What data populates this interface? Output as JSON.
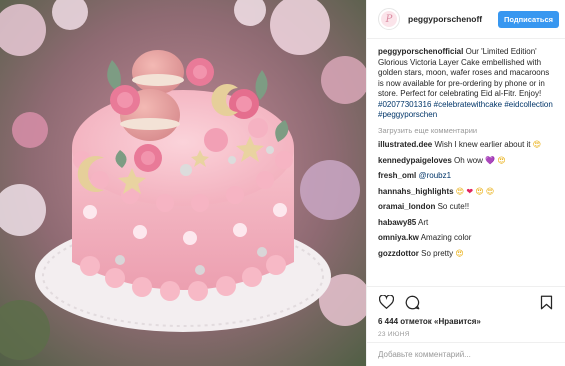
{
  "header": {
    "username": "peggyporschenoff",
    "follow_label": "Подписаться",
    "avatar_letter": "P"
  },
  "caption": {
    "username": "peggyporschenofficial",
    "text": "Our 'Limited Edition' Glorious Victoria Layer Cake embellished with golden stars, moon, wafer roses and macaroons is now available for pre-ordering by phone or in store. Perfect for celebrating Eid al-Fitr. Enjoy!",
    "hashtags": [
      "#02077301316",
      "#celebratewithcake",
      "#eidcollection",
      "#peggyporschen"
    ]
  },
  "load_more": "Загрузить еще комментарии",
  "comments": [
    {
      "username": "illustrated.dee",
      "text": "Wish I knew earlier about it",
      "emojis": [
        {
          "char": "😍",
          "color": "yellow"
        }
      ]
    },
    {
      "username": "kennedypaigeloves",
      "text": "Oh wow",
      "emojis": [
        {
          "char": "💜",
          "color": "purple"
        },
        {
          "char": "😍",
          "color": "yellow"
        }
      ]
    },
    {
      "username": "fresh_oml",
      "text": "",
      "mention": "@roubz1"
    },
    {
      "username": "hannahs_highlights",
      "text": "",
      "emojis": [
        {
          "char": "😍",
          "color": "yellow"
        },
        {
          "char": "❤",
          "color": "red"
        },
        {
          "char": "😍",
          "color": "yellow"
        },
        {
          "char": "😍",
          "color": "yellow"
        }
      ]
    },
    {
      "username": "oramai_london",
      "text": "So cute!!"
    },
    {
      "username": "habawy85",
      "text": "Art"
    },
    {
      "username": "omniya.kw",
      "text": "Amazing color"
    },
    {
      "username": "gozzdottor",
      "text": "So pretty",
      "emojis": [
        {
          "char": "😍",
          "color": "yellow"
        }
      ]
    }
  ],
  "icons": {
    "like": "heart-icon",
    "comment": "comment-icon",
    "save": "bookmark-icon"
  },
  "likes": "6 444 отметок «Нравится»",
  "date": "23 июня",
  "add_comment_placeholder": "Добавьте комментарий...",
  "colors": {
    "accent": "#3897f0",
    "link": "#003569",
    "muted": "#999999",
    "cake_pink": "#f2a7b6"
  }
}
